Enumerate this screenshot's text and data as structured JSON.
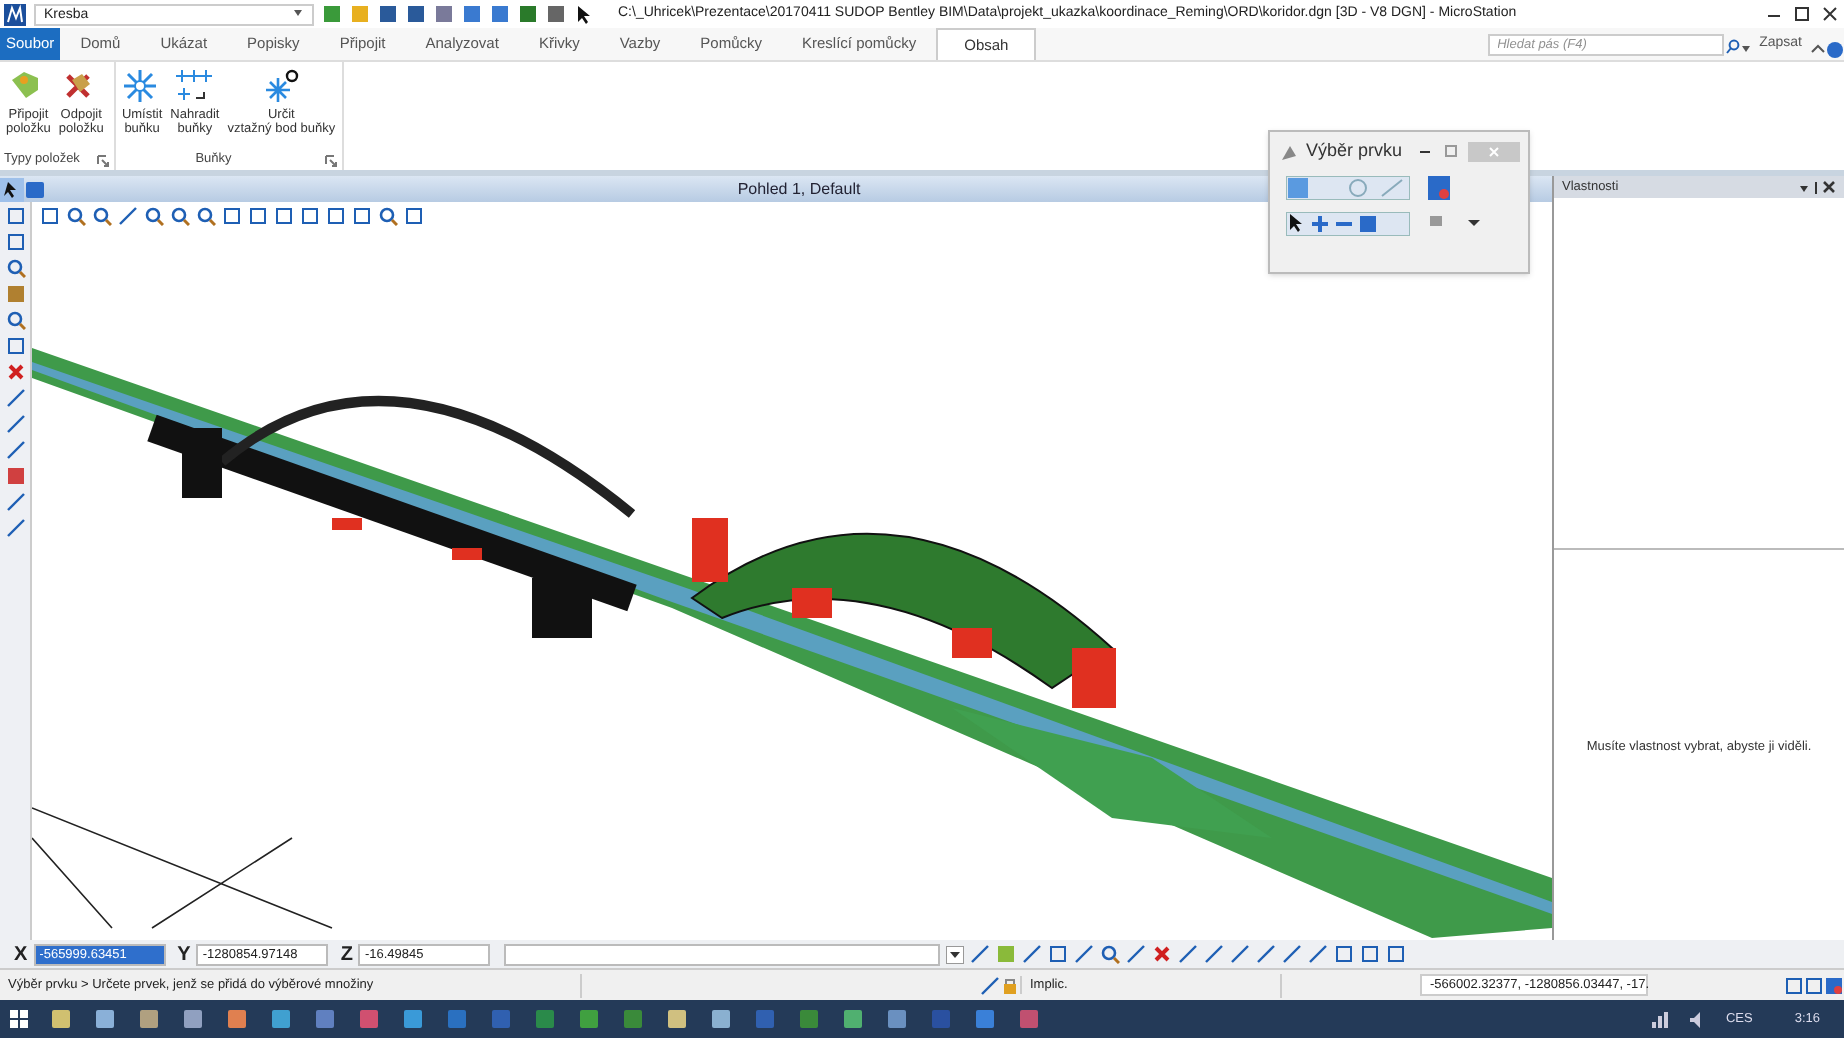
{
  "title_bar": {
    "workflow": "Kresba",
    "title": "C:\\_Uhricek\\Prezentace\\20170411 SUDOP Bentley BIM\\Data\\projekt_ukazka\\koordinace_Reming\\ORD\\koridor.dgn [3D - V8 DGN] - MicroStation"
  },
  "file_tab": "Soubor",
  "tabs": [
    {
      "label": "Domů",
      "selected": false
    },
    {
      "label": "Ukázat",
      "selected": false
    },
    {
      "label": "Popisky",
      "selected": false
    },
    {
      "label": "Připojit",
      "selected": false
    },
    {
      "label": "Analyzovat",
      "selected": false
    },
    {
      "label": "Křivky",
      "selected": false
    },
    {
      "label": "Vazby",
      "selected": false
    },
    {
      "label": "Pomůcky",
      "selected": false
    },
    {
      "label": "Kreslící pomůcky",
      "selected": false
    },
    {
      "label": "Obsah",
      "selected": true
    }
  ],
  "ribbon_search": {
    "placeholder": "Hledat pás (F4)"
  },
  "sign_in": "Zapsat",
  "groups": [
    {
      "name": "Typy položek",
      "buttons": [
        {
          "lines": [
            "Připojit",
            "položku"
          ],
          "kind": "tag-add"
        },
        {
          "lines": [
            "Odpojit",
            "položku"
          ],
          "kind": "tag-remove"
        }
      ]
    },
    {
      "name": "Buňky",
      "buttons": [
        {
          "lines": [
            "Umístit",
            "buňku"
          ],
          "kind": "cell"
        },
        {
          "lines": [
            "Nahradit",
            "buňky"
          ],
          "kind": "cells"
        },
        {
          "lines": [
            "Určit",
            "vztažný bod buňky"
          ],
          "kind": "origin"
        }
      ]
    }
  ],
  "view": {
    "title": "Pohled 1, Default"
  },
  "selection_dialog": {
    "title": "Výběr prvku"
  },
  "properties": {
    "title": "Vlastnosti",
    "message": "Musíte vlastnost vybrat, abyste ji viděli."
  },
  "coordinates": [
    {
      "axis": "X",
      "value": "-565999.63451",
      "selected": true
    },
    {
      "axis": "Y",
      "value": "-1280854.97148",
      "selected": false
    },
    {
      "axis": "Z",
      "value": "-16.49845",
      "selected": false
    }
  ],
  "status_bar": {
    "prompt": "Výběr prvku > Určete prvek, jenž se přidá do výběrové množiny",
    "level": "Implic.",
    "position": "-566002.32377, -1280856.03447, -17."
  },
  "taskbar": {
    "language": "CES",
    "time": "3:16"
  }
}
